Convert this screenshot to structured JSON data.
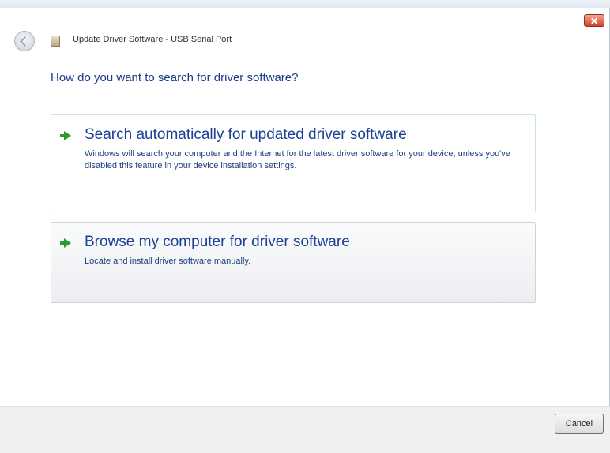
{
  "window": {
    "title": "Update Driver Software - USB Serial Port"
  },
  "main": {
    "instruction": "How do you want to search for driver software?",
    "options": [
      {
        "title": "Search automatically for updated driver software",
        "description": "Windows will search your computer and the Internet for the latest driver software for your device, unless you've disabled this feature in your device installation settings."
      },
      {
        "title": "Browse my computer for driver software",
        "description": "Locate and install driver software manually."
      }
    ]
  },
  "footer": {
    "cancel_label": "Cancel"
  },
  "icons": {
    "back": "back-arrow-icon",
    "device": "device-icon",
    "option_arrow": "green-arrow-icon",
    "close": "close-icon"
  },
  "colors": {
    "instruction_text": "#1a3a8a",
    "option_title": "#1c3f95",
    "arrow": "#2e9c2c",
    "close_button": "#d0442b"
  }
}
